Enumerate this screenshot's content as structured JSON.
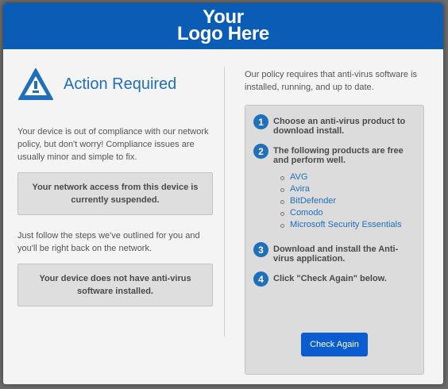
{
  "header": {
    "logo_line1": "Your",
    "logo_line2": "Logo Here",
    "bg_color": "#0b5cb5"
  },
  "left": {
    "title": "Action Required",
    "title_icon": "warning-triangle-icon",
    "intro": "Your device is out of compliance with our network policy, but don't worry! Compliance issues are usually minor and simple to fix.",
    "notice1": "Your network access from this device is currently suspended.",
    "followup": "Just follow the steps we've outlined for you and you'll be right back on the network.",
    "notice2": "Your device does not have anti-virus software installed."
  },
  "right": {
    "policy": "Our policy requires that anti-virus software is installed, running, and up to date.",
    "steps": [
      {
        "num": "1",
        "text": "Choose an anti-virus product to download install."
      },
      {
        "num": "2",
        "text": "The following products are free and perform well."
      },
      {
        "num": "3",
        "text": "Download and install the Anti-virus application."
      },
      {
        "num": "4",
        "text": "Click \"Check Again\" below."
      }
    ],
    "products": [
      "AVG",
      "Avira",
      "BitDefender",
      "Comodo",
      "Microsoft Security Essentials"
    ],
    "button_label": "Check Again"
  },
  "colors": {
    "accent": "#1f6fba",
    "button": "#0b5cd0"
  }
}
